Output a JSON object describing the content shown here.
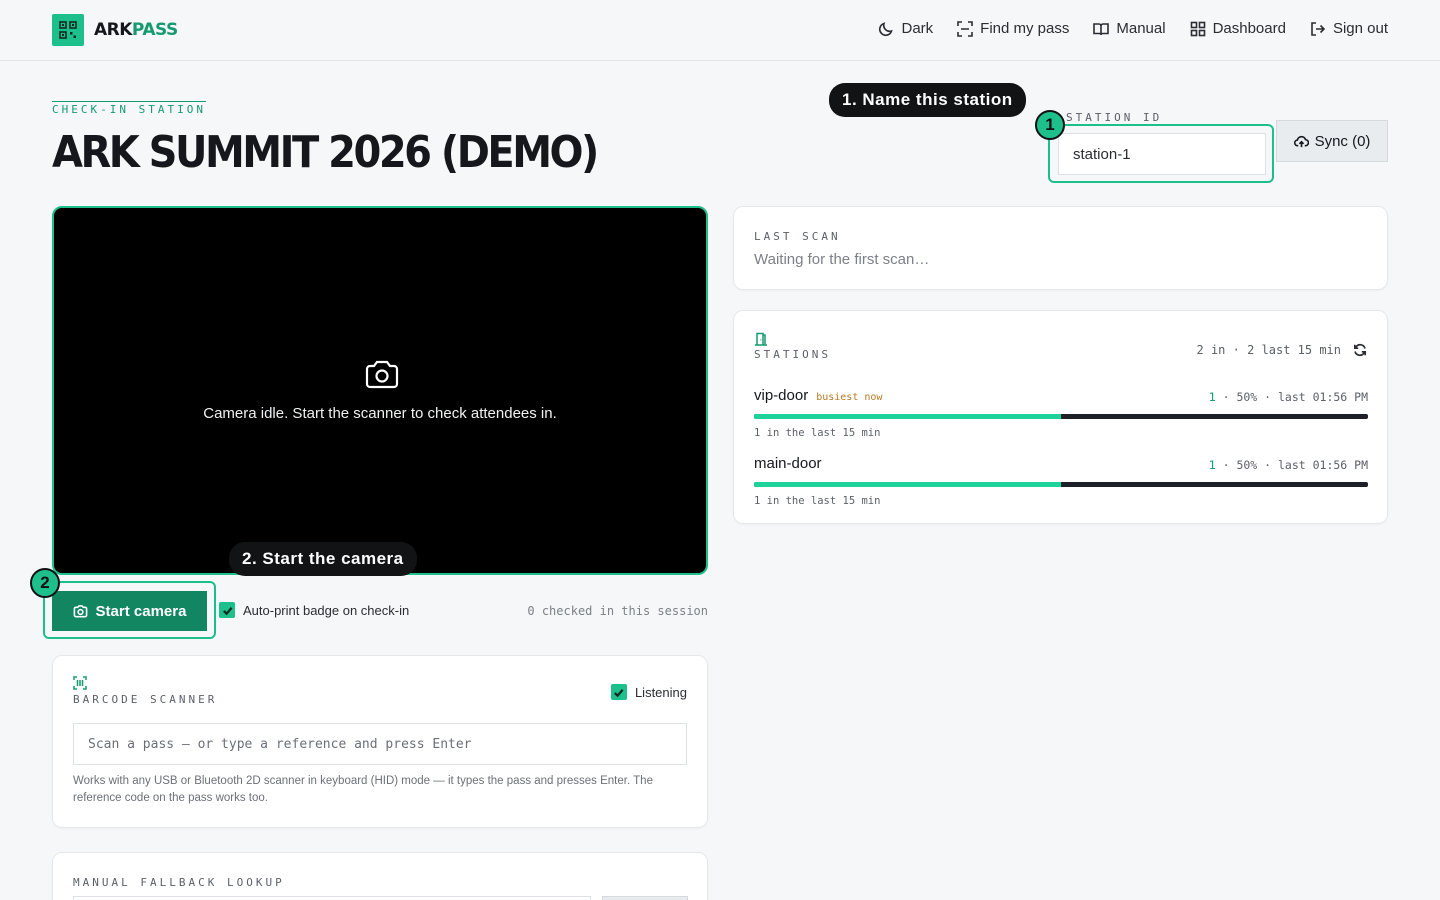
{
  "app": {
    "logo_part1": "ARK",
    "logo_part2": "PASS",
    "accent_color": "#1dbf8a"
  },
  "nav": {
    "items": [
      {
        "label": "Dark",
        "icon": "moon-icon"
      },
      {
        "label": "Find my pass",
        "icon": "scan-frame-icon"
      },
      {
        "label": "Manual",
        "icon": "book-icon"
      },
      {
        "label": "Dashboard",
        "icon": "grid-icon"
      },
      {
        "label": "Sign out",
        "icon": "logout-icon"
      }
    ]
  },
  "header": {
    "eyebrow": "CHECK-IN STATION",
    "title": "ARK SUMMIT 2026 (DEMO)"
  },
  "tour": {
    "step1_number": "1",
    "step1_tip": "1. Name this station",
    "step2_number": "2",
    "step2_tip": "2. Start the camera"
  },
  "station": {
    "label": "STATION ID",
    "value": "station-1",
    "sync_label": "Sync (0)"
  },
  "camera": {
    "status_text": "Camera idle. Start the scanner to check attendees in.",
    "start_label": "Start camera",
    "autoprint_label": "Auto-print badge on check-in",
    "autoprint_checked": true,
    "session_count": "0 checked in this session"
  },
  "barcode": {
    "label": "BARCODE SCANNER",
    "listening_label": "Listening",
    "listening_checked": true,
    "placeholder": "Scan a pass — or type a reference and press Enter",
    "help": "Works with any USB or Bluetooth 2D scanner in keyboard (HID) mode — it types the pass and presses Enter. The reference code on the pass works too."
  },
  "manual": {
    "label": "MANUAL FALLBACK LOOKUP"
  },
  "last_scan": {
    "label": "LAST SCAN",
    "text": "Waiting for the first scan…"
  },
  "stations": {
    "label": "STATIONS",
    "summary": "2 in · 2 last 15 min",
    "rows": [
      {
        "name": "vip-door",
        "tag": "busiest now",
        "count": "1",
        "meta": " · 50% · last 01:56 PM",
        "share": 0.5,
        "sub": "1 in the last 15 min"
      },
      {
        "name": "main-door",
        "tag": "",
        "count": "1",
        "meta": " · 50% · last 01:56 PM",
        "share": 0.5,
        "sub": "1 in the last 15 min"
      }
    ]
  }
}
